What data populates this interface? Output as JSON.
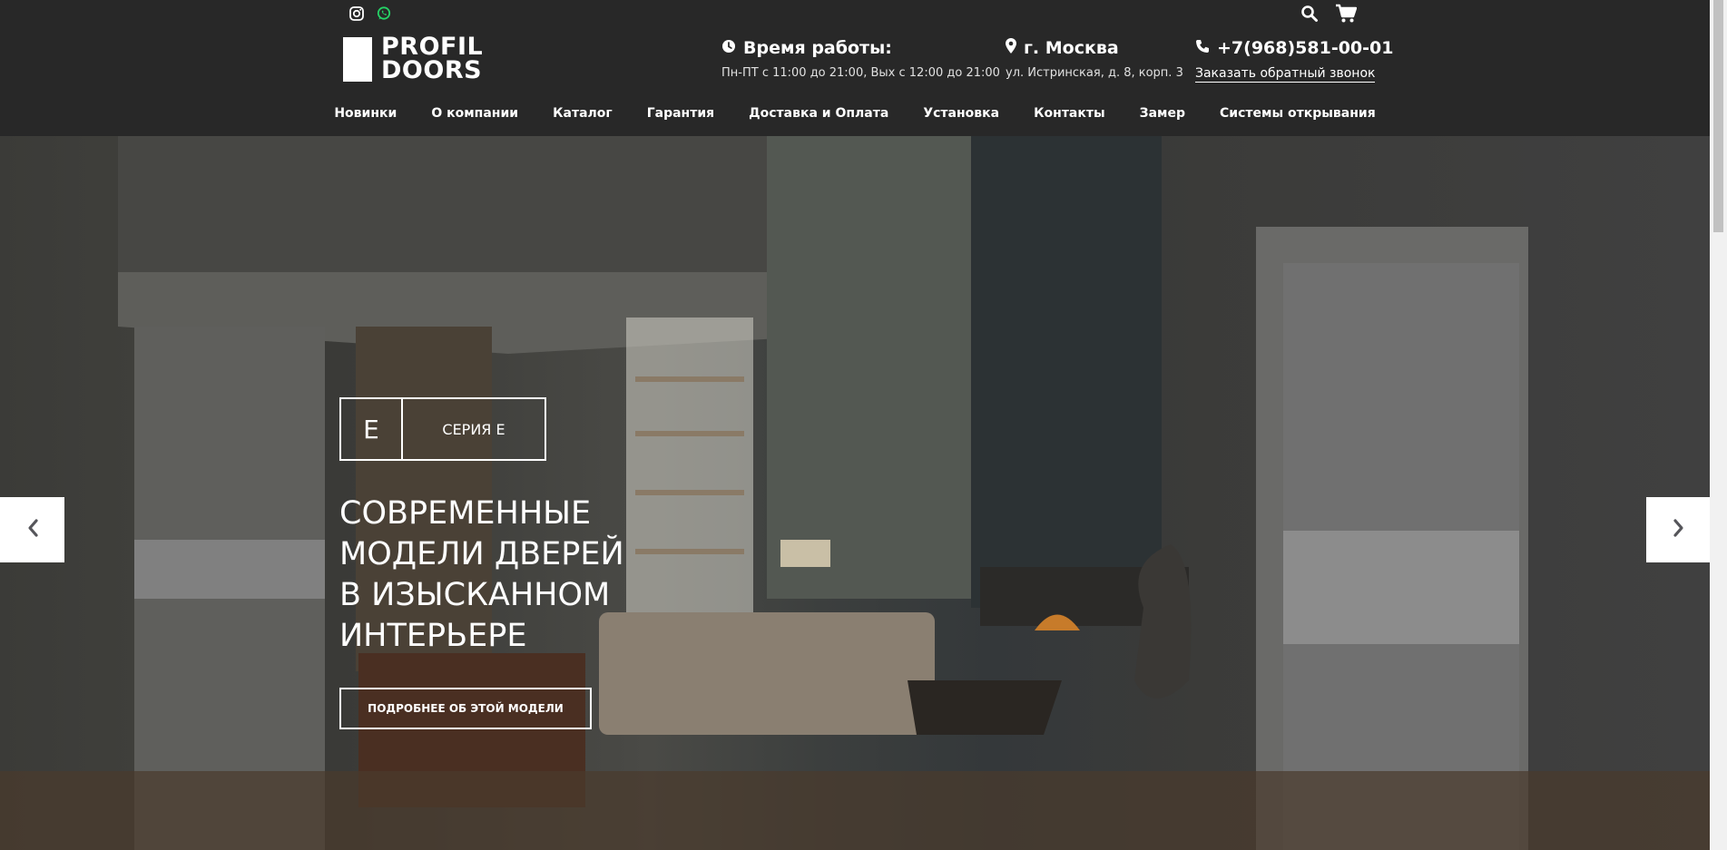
{
  "header": {
    "social": {
      "instagram_icon": "instagram-icon",
      "whatsapp_icon": "whatsapp-icon",
      "whatsapp_color": "#25d366"
    },
    "logo": {
      "line1": "PROFIL",
      "line2": "DOORS"
    },
    "hours": {
      "title": "Время работы:",
      "detail": "Пн-ПТ с 11:00 до 21:00, Вых с 12:00 до 21:00"
    },
    "location": {
      "title": "г. Москва",
      "detail": "ул. Истринская, д. 8, корп. 3"
    },
    "phone": {
      "number": "+7(968)581-00-01",
      "callback": "Заказать обратный звонок"
    }
  },
  "nav": {
    "items": [
      {
        "label": "Новинки"
      },
      {
        "label": "О компании"
      },
      {
        "label": "Каталог"
      },
      {
        "label": "Гарантия"
      },
      {
        "label": "Доставка и Оплата"
      },
      {
        "label": "Установка"
      },
      {
        "label": "Контакты"
      },
      {
        "label": "Замер"
      },
      {
        "label": "Системы открывания"
      }
    ]
  },
  "hero": {
    "series_letter": "E",
    "series_name": "СЕРИЯ Е",
    "headline": [
      "СОВРЕМЕННЫЕ",
      "МОДЕЛИ ДВЕРЕЙ",
      "В ИЗЫСКАННОМ",
      "ИНТЕРЬЕРЕ"
    ],
    "cta": "ПОДРОБНЕЕ ОБ ЭТОЙ МОДЕЛИ"
  },
  "colors": {
    "header_bg": "#282828",
    "text": "#ffffff"
  }
}
